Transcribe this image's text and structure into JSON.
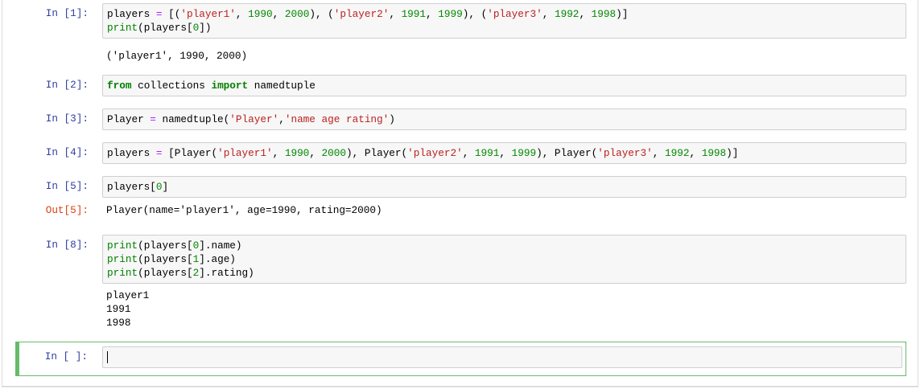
{
  "cells": [
    {
      "prompt": "In [1]:",
      "input": [
        [
          [
            "players ",
            "pl"
          ],
          [
            "=",
            "op"
          ],
          [
            " [(",
            "pl"
          ],
          [
            "'player1'",
            "st"
          ],
          [
            ", ",
            "pl"
          ],
          [
            "1990",
            "nu"
          ],
          [
            ", ",
            "pl"
          ],
          [
            "2000",
            "nu"
          ],
          [
            "), (",
            "pl"
          ],
          [
            "'player2'",
            "st"
          ],
          [
            ", ",
            "pl"
          ],
          [
            "1991",
            "nu"
          ],
          [
            ", ",
            "pl"
          ],
          [
            "1999",
            "nu"
          ],
          [
            "), (",
            "pl"
          ],
          [
            "'player3'",
            "st"
          ],
          [
            ", ",
            "pl"
          ],
          [
            "1992",
            "nu"
          ],
          [
            ", ",
            "pl"
          ],
          [
            "1998",
            "nu"
          ],
          [
            ")]",
            "pl"
          ]
        ],
        [
          [
            "print",
            "bi"
          ],
          [
            "(players[",
            "pl"
          ],
          [
            "0",
            "nu"
          ],
          [
            "])",
            "pl"
          ]
        ]
      ],
      "output": [
        "('player1', 1990, 2000)"
      ]
    },
    {
      "prompt": "In [2]:",
      "input": [
        [
          [
            "from",
            "kw"
          ],
          [
            " collections ",
            "pl"
          ],
          [
            "import",
            "kw"
          ],
          [
            " namedtuple",
            "pl"
          ]
        ]
      ]
    },
    {
      "prompt": "In [3]:",
      "input": [
        [
          [
            "Player ",
            "pl"
          ],
          [
            "=",
            "op"
          ],
          [
            " namedtuple(",
            "pl"
          ],
          [
            "'Player'",
            "st"
          ],
          [
            ",",
            "pl"
          ],
          [
            "'name age rating'",
            "st"
          ],
          [
            ")",
            "pl"
          ]
        ]
      ]
    },
    {
      "prompt": "In [4]:",
      "input": [
        [
          [
            "players ",
            "pl"
          ],
          [
            "=",
            "op"
          ],
          [
            " [Player(",
            "pl"
          ],
          [
            "'player1'",
            "st"
          ],
          [
            ", ",
            "pl"
          ],
          [
            "1990",
            "nu"
          ],
          [
            ", ",
            "pl"
          ],
          [
            "2000",
            "nu"
          ],
          [
            "), Player(",
            "pl"
          ],
          [
            "'player2'",
            "st"
          ],
          [
            ", ",
            "pl"
          ],
          [
            "1991",
            "nu"
          ],
          [
            ", ",
            "pl"
          ],
          [
            "1999",
            "nu"
          ],
          [
            "), Player(",
            "pl"
          ],
          [
            "'player3'",
            "st"
          ],
          [
            ", ",
            "pl"
          ],
          [
            "1992",
            "nu"
          ],
          [
            ", ",
            "pl"
          ],
          [
            "1998",
            "nu"
          ],
          [
            ")]",
            "pl"
          ]
        ]
      ]
    },
    {
      "prompt": "In [5]:",
      "input": [
        [
          [
            "players[",
            "pl"
          ],
          [
            "0",
            "nu"
          ],
          [
            "]",
            "pl"
          ]
        ]
      ],
      "out_prompt": "Out[5]:",
      "output": [
        "Player(name='player1', age=1990, rating=2000)"
      ]
    },
    {
      "prompt": "In [8]:",
      "input": [
        [
          [
            "print",
            "bi"
          ],
          [
            "(players[",
            "pl"
          ],
          [
            "0",
            "nu"
          ],
          [
            "].name)",
            "pl"
          ]
        ],
        [
          [
            "print",
            "bi"
          ],
          [
            "(players[",
            "pl"
          ],
          [
            "1",
            "nu"
          ],
          [
            "].age)",
            "pl"
          ]
        ],
        [
          [
            "print",
            "bi"
          ],
          [
            "(players[",
            "pl"
          ],
          [
            "2",
            "nu"
          ],
          [
            "].rating)",
            "pl"
          ]
        ]
      ],
      "output": [
        "player1",
        "1991",
        "1998"
      ]
    },
    {
      "prompt": "In [ ]:",
      "input": [],
      "selected": true
    }
  ]
}
